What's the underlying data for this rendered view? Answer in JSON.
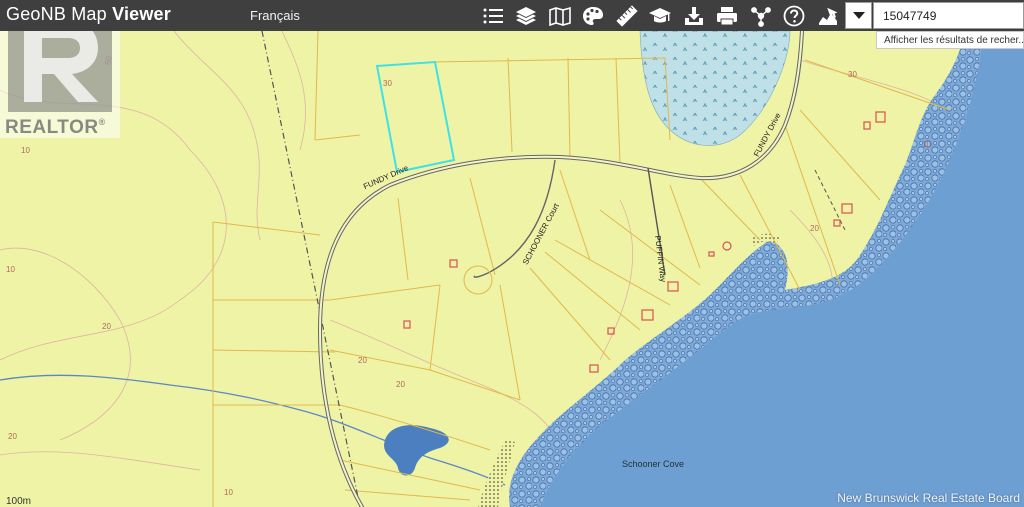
{
  "app": {
    "title_light": "GeoNB Map",
    "title_bold": "Viewer",
    "language_link": "Français"
  },
  "toolbar": {
    "tools": [
      {
        "name": "layer-list-icon"
      },
      {
        "name": "layers-icon"
      },
      {
        "name": "basemap-icon"
      },
      {
        "name": "palette-icon"
      },
      {
        "name": "measure-ruler-icon"
      },
      {
        "name": "education-icon"
      },
      {
        "name": "download-icon"
      },
      {
        "name": "print-icon"
      },
      {
        "name": "share-icon"
      },
      {
        "name": "help-icon"
      },
      {
        "name": "identify-icon"
      }
    ],
    "colors": {
      "bar": "#3f3f3f",
      "icon": "#ffffff"
    }
  },
  "search": {
    "dropdown_icon": "caret-down-icon",
    "value": "15047749",
    "tooltip": "Afficher les résultats de recher..."
  },
  "watermark": {
    "brand": "REALTOR",
    "registered": "®"
  },
  "map": {
    "roads": {
      "fundy_1": "FUNDY Drive",
      "fundy_2": "FUNDY Drive",
      "schooner": "SCHOONER Court",
      "puffin": "PUFFIN Way"
    },
    "places": {
      "cove": "Schooner Cove"
    },
    "contours": [
      "30",
      "30",
      "50",
      "10",
      "10",
      "20",
      "20",
      "10",
      "20",
      "20",
      "20",
      "10"
    ],
    "scale_label": "100m",
    "colors": {
      "land": "#eef3a6",
      "water": "#6e9fd3",
      "parcel": "#e3b84a",
      "selected_parcel": "#3ee1e6",
      "road": "#555555",
      "building": "#d9534f"
    }
  },
  "credit": "New Brunswick Real Estate Board"
}
